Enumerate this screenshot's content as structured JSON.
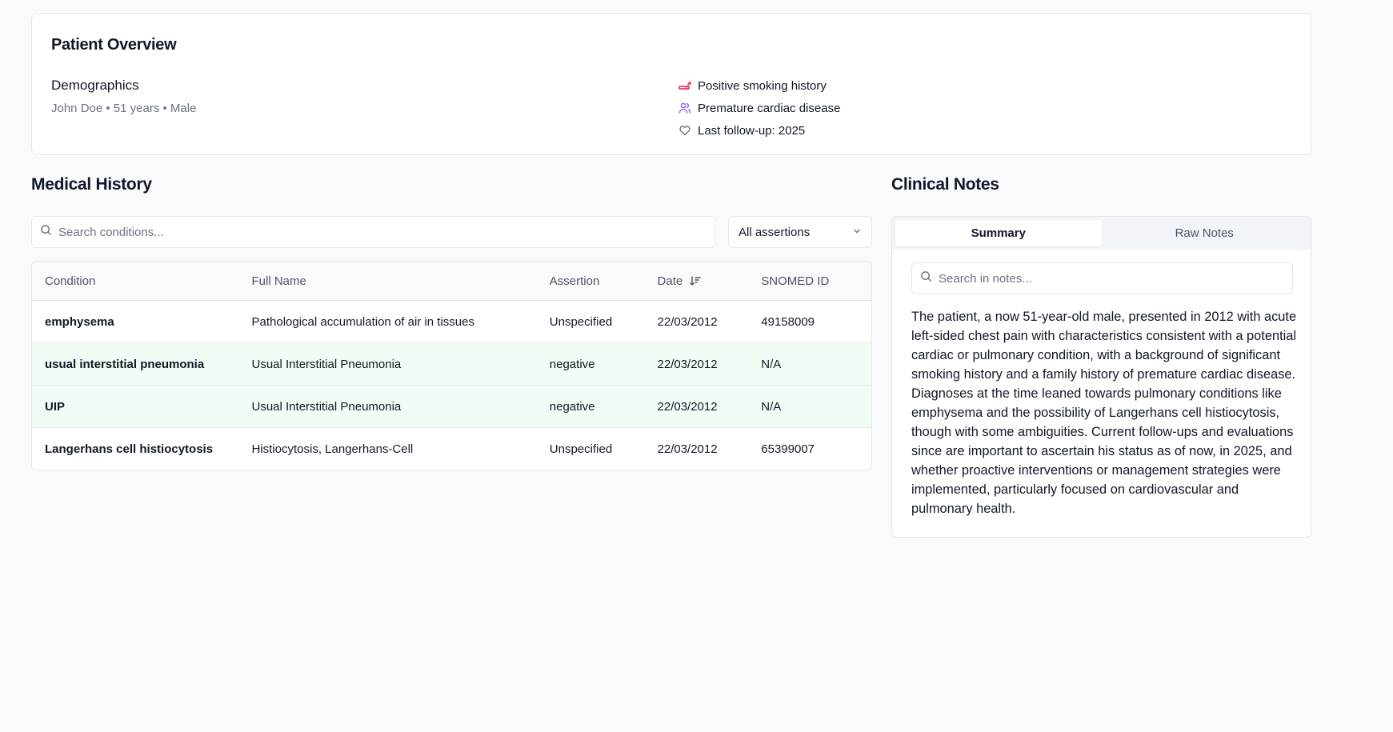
{
  "overview": {
    "title": "Patient Overview",
    "demographics_heading": "Demographics",
    "demographics_text": "John Doe • 51 years • Male",
    "flags": [
      {
        "icon": "cigarette-icon",
        "label": "Positive smoking history",
        "color": "#e11d48"
      },
      {
        "icon": "users-icon",
        "label": "Premature cardiac disease",
        "color": "#8b5cf6"
      },
      {
        "icon": "heart-icon",
        "label": "Last follow-up: 2025",
        "color": "#6b7280"
      }
    ]
  },
  "history": {
    "title": "Medical History",
    "search_placeholder": "Search conditions...",
    "filter_value": "All assertions",
    "columns": [
      "Condition",
      "Full Name",
      "Assertion",
      "Date",
      "SNOMED ID"
    ],
    "rows": [
      {
        "condition": "emphysema",
        "full_name": "Pathological accumulation of air in tissues",
        "assertion": "Unspecified",
        "date": "22/03/2012",
        "snomed": "49158009",
        "highlight": false
      },
      {
        "condition": "usual interstitial pneumonia",
        "full_name": "Usual Interstitial Pneumonia",
        "assertion": "negative",
        "date": "22/03/2012",
        "snomed": "N/A",
        "highlight": true
      },
      {
        "condition": "UIP",
        "full_name": "Usual Interstitial Pneumonia",
        "assertion": "negative",
        "date": "22/03/2012",
        "snomed": "N/A",
        "highlight": true
      },
      {
        "condition": "Langerhans cell histiocytosis",
        "full_name": "Histiocytosis, Langerhans-Cell",
        "assertion": "Unspecified",
        "date": "22/03/2012",
        "snomed": "65399007",
        "highlight": false
      }
    ]
  },
  "notes": {
    "title": "Clinical Notes",
    "tabs": [
      "Summary",
      "Raw Notes"
    ],
    "active_tab": "Summary",
    "search_placeholder": "Search in notes...",
    "summary": "The patient, a now 51-year-old male, presented in 2012 with acute left-sided chest pain with characteristics consistent with a potential cardiac or pulmonary condition, with a background of significant smoking history and a family history of premature cardiac disease. Diagnoses at the time leaned towards pulmonary conditions like emphysema and the possibility of Langerhans cell histiocytosis, though with some ambiguities. Current follow-ups and evaluations since are important to ascertain his status as of now, in 2025, and whether proactive interventions or management strategies were implemented, particularly focused on cardiovascular and pulmonary health."
  }
}
